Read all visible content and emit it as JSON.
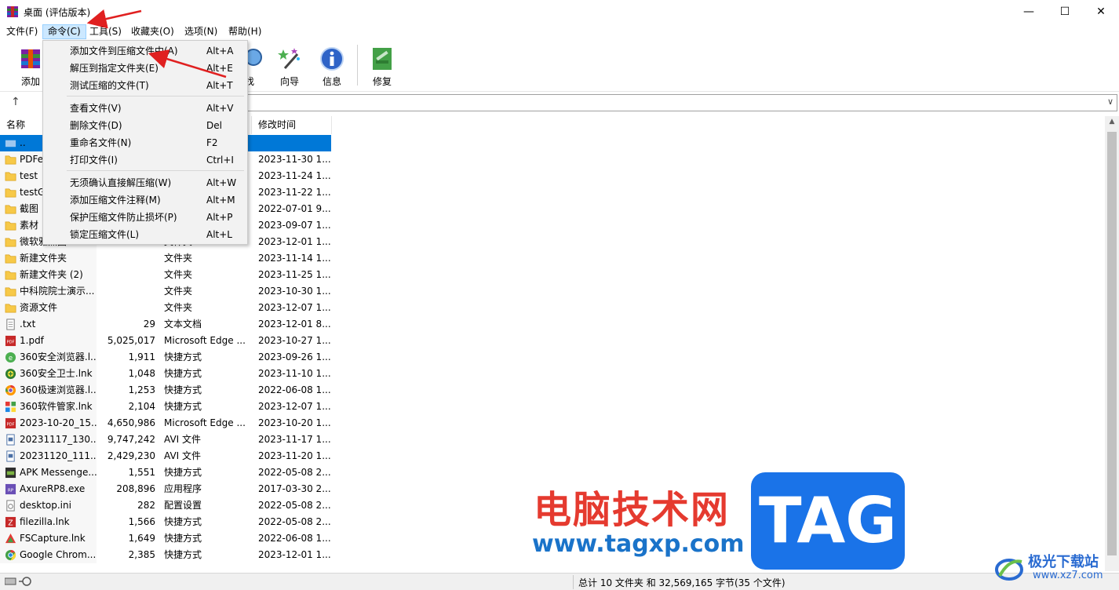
{
  "window": {
    "title": "桌面 (评估版本)",
    "min_glyph": "—",
    "max_glyph": "☐",
    "close_glyph": "✕"
  },
  "menubar": {
    "items": [
      "文件(F)",
      "命令(C)",
      "工具(S)",
      "收藏夹(O)",
      "选项(N)",
      "帮助(H)"
    ],
    "active_index": 1
  },
  "toolbar": {
    "add_label": "添加",
    "find_label_partial": "找",
    "wizard_label": "向导",
    "info_label": "信息",
    "repair_label": "修复"
  },
  "addressbar": {
    "up_glyph": "↑",
    "dropdown_glyph": "∨"
  },
  "columns": {
    "name": "名称",
    "modified": "修改时间"
  },
  "files": [
    {
      "name": "..",
      "size": "",
      "type": "",
      "date": "",
      "icon": "parent-folder",
      "selected": true
    },
    {
      "name": "PDFe",
      "size": "",
      "type": "",
      "date": "2023-11-30 1...",
      "icon": "folder"
    },
    {
      "name": "test",
      "size": "",
      "type": "",
      "date": "2023-11-24 1...",
      "icon": "folder"
    },
    {
      "name": "testG",
      "size": "",
      "type": "",
      "date": "2023-11-22 1...",
      "icon": "folder"
    },
    {
      "name": "截图",
      "size": "",
      "type": "",
      "date": "2022-07-01 9...",
      "icon": "folder"
    },
    {
      "name": "素材",
      "size": "",
      "type": "",
      "date": "2023-09-07 1...",
      "icon": "folder"
    },
    {
      "name": "微软雅黑图",
      "size": "",
      "type": "文件夹",
      "date": "2023-12-01 1...",
      "icon": "folder"
    },
    {
      "name": "新建文件夹",
      "size": "",
      "type": "文件夹",
      "date": "2023-11-14 1...",
      "icon": "folder"
    },
    {
      "name": "新建文件夹 (2)",
      "size": "",
      "type": "文件夹",
      "date": "2023-11-25 1...",
      "icon": "folder"
    },
    {
      "name": "中科院院士演示...",
      "size": "",
      "type": "文件夹",
      "date": "2023-10-30 1...",
      "icon": "folder"
    },
    {
      "name": "资源文件",
      "size": "",
      "type": "文件夹",
      "date": "2023-12-07 1...",
      "icon": "folder"
    },
    {
      "name": ".txt",
      "size": "29",
      "type": "文本文档",
      "date": "2023-12-01 8...",
      "icon": "text-file"
    },
    {
      "name": "1.pdf",
      "size": "5,025,017",
      "type": "Microsoft Edge ...",
      "date": "2023-10-27 1...",
      "icon": "pdf"
    },
    {
      "name": "360安全浏览器.l...",
      "size": "1,911",
      "type": "快捷方式",
      "date": "2023-09-26 1...",
      "icon": "browser-360"
    },
    {
      "name": "360安全卫士.lnk",
      "size": "1,048",
      "type": "快捷方式",
      "date": "2023-11-10 1...",
      "icon": "guard-360"
    },
    {
      "name": "360极速浏览器.l...",
      "size": "1,253",
      "type": "快捷方式",
      "date": "2022-06-08 1...",
      "icon": "chrome-like"
    },
    {
      "name": "360软件管家.lnk",
      "size": "2,104",
      "type": "快捷方式",
      "date": "2023-12-07 1...",
      "icon": "apps"
    },
    {
      "name": "2023-10-20_15...",
      "size": "4,650,986",
      "type": "Microsoft Edge ...",
      "date": "2023-10-20 1...",
      "icon": "pdf"
    },
    {
      "name": "20231117_130...",
      "size": "9,747,242",
      "type": "AVI 文件",
      "date": "2023-11-17 1...",
      "icon": "video-file"
    },
    {
      "name": "20231120_111...",
      "size": "2,429,230",
      "type": "AVI 文件",
      "date": "2023-11-20 1...",
      "icon": "video-file"
    },
    {
      "name": "APK Messenge...",
      "size": "1,551",
      "type": "快捷方式",
      "date": "2022-05-08 2...",
      "icon": "apk"
    },
    {
      "name": "AxureRP8.exe",
      "size": "208,896",
      "type": "应用程序",
      "date": "2017-03-30 2...",
      "icon": "axure"
    },
    {
      "name": "desktop.ini",
      "size": "282",
      "type": "配置设置",
      "date": "2022-05-08 2...",
      "icon": "ini-file"
    },
    {
      "name": "filezilla.lnk",
      "size": "1,566",
      "type": "快捷方式",
      "date": "2022-05-08 2...",
      "icon": "filezilla"
    },
    {
      "name": "FSCapture.lnk",
      "size": "1,649",
      "type": "快捷方式",
      "date": "2022-06-08 1...",
      "icon": "fscapture"
    },
    {
      "name": "Google Chrom...",
      "size": "2,385",
      "type": "快捷方式",
      "date": "2023-12-01 1...",
      "icon": "chrome"
    }
  ],
  "command_menu": {
    "items": [
      {
        "label": "添加文件到压缩文件中(A)",
        "shortcut": "Alt+A"
      },
      {
        "label": "解压到指定文件夹(E)",
        "shortcut": "Alt+E"
      },
      {
        "label": "测试压缩的文件(T)",
        "shortcut": "Alt+T"
      },
      {
        "label": "查看文件(V)",
        "shortcut": "Alt+V"
      },
      {
        "label": "删除文件(D)",
        "shortcut": "Del"
      },
      {
        "label": "重命名文件(N)",
        "shortcut": "F2"
      },
      {
        "label": "打印文件(I)",
        "shortcut": "Ctrl+I"
      },
      {
        "label": "无须确认直接解压缩(W)",
        "shortcut": "Alt+W"
      },
      {
        "label": "添加压缩文件注释(M)",
        "shortcut": "Alt+M"
      },
      {
        "label": "保护压缩文件防止损坏(P)",
        "shortcut": "Alt+P"
      },
      {
        "label": "锁定压缩文件(L)",
        "shortcut": "Alt+L"
      }
    ]
  },
  "statusbar": {
    "summary": "总计 10 文件夹 和 32,569,165 字节(35 个文件)"
  },
  "watermark": {
    "cn_text": "电脑技术网",
    "url": "www.tagxp.com",
    "tag": "TAG",
    "corner_cn": "极光下载站",
    "corner_url": "www.xz7.com"
  },
  "colors": {
    "selection": "#0078d7",
    "menu_active_bg": "#cce8ff",
    "arrow": "#e02020",
    "folder": "#f7c948"
  }
}
